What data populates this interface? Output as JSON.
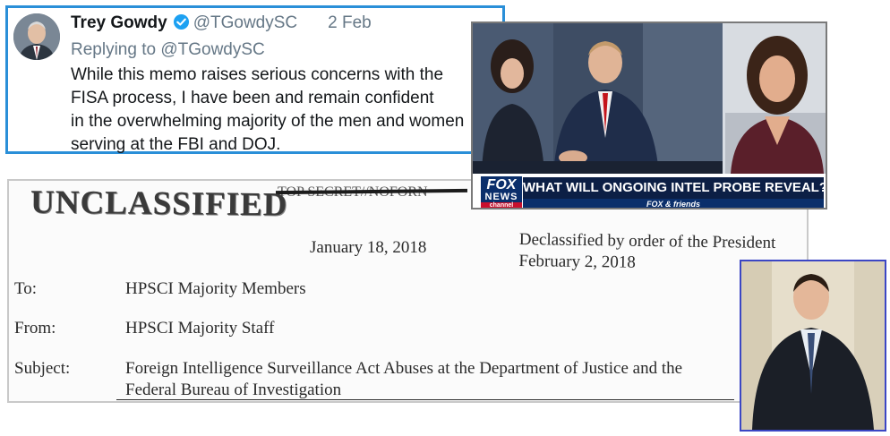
{
  "tweet": {
    "name": "Trey Gowdy",
    "handle": "@TGowdySC",
    "date": "2 Feb",
    "replying_to": "Replying to @TGowdySC",
    "lines": [
      "While this memo raises serious concerns with the",
      "FISA process, I have been and remain confident",
      "in the overwhelming majority of the men and women",
      "serving at the FBI and DOJ."
    ],
    "verified_icon": "verified-badge-icon",
    "verified_color": "#1da1f2"
  },
  "memo": {
    "stamp": "UNCLASSIFIED",
    "struck_text": "TOP SECRET//NOFORN",
    "date": "January 18, 2018",
    "declassified_lines": [
      "Declassified by order of the President",
      "February 2, 2018"
    ],
    "to_label": "To:",
    "to_value": "HPSCI Majority Members",
    "from_label": "From:",
    "from_value": "HPSCI Majority Staff",
    "subject_label": "Subject:",
    "subject_lines": [
      "Foreign Intelligence Surveillance Act Abuses at the Department of Justice and the",
      "Federal Bureau of Investigation"
    ]
  },
  "fox": {
    "logo_line1": "FOX",
    "logo_line2": "NEWS",
    "logo_line3": "channel",
    "headline": "WHAT WILL ONGOING INTEL PROBE REVEAL?",
    "show": "FOX & friends"
  },
  "colors": {
    "tweet_border": "#2a8fd8",
    "photo_border": "#3b46c4",
    "fox_blue": "#0c1f45"
  }
}
